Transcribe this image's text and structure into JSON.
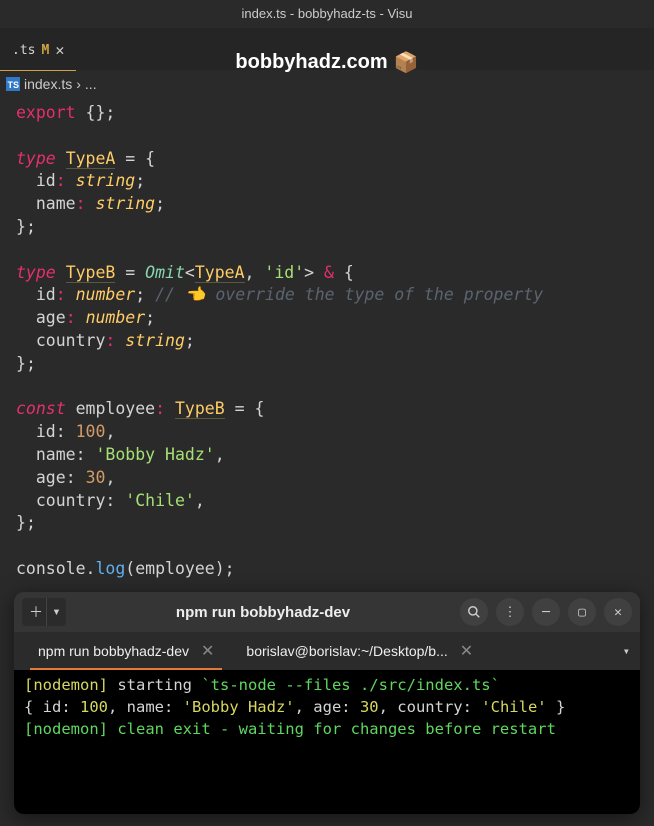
{
  "window": {
    "title": "index.ts - bobbyhadz-ts - Visu"
  },
  "header": {
    "site_name": "bobbyhadz.com",
    "icon": "📦"
  },
  "tabs": [
    {
      "filename": ".ts",
      "modified": "M",
      "close": "✕"
    }
  ],
  "breadcrumb": {
    "icon": "TS",
    "file": "index.ts",
    "sep": "›",
    "symbol": "..."
  },
  "code": {
    "l1": {
      "export": "export",
      "braces": "{}",
      "semi": ";"
    },
    "l2": {
      "type": "type",
      "name": "TypeA",
      "eq": " = ",
      "brace": "{"
    },
    "l3": {
      "prop": "id",
      "colon": ":",
      "ptype": "string",
      "semi": ";"
    },
    "l4": {
      "prop": "name",
      "colon": ":",
      "ptype": "string",
      "semi": ";"
    },
    "l5": {
      "brace": "}",
      "semi": ";"
    },
    "l6": {
      "type": "type",
      "name": "TypeB",
      "eq": " = ",
      "omit": "Omit",
      "lt": "<",
      "ref": "TypeA",
      "comma": ", ",
      "str": "'id'",
      "gt": ">",
      "amp": " & ",
      "brace": "{"
    },
    "l7": {
      "prop": "id",
      "colon": ":",
      "ptype": "number",
      "semi": ";",
      "comment": "// 👈️ override the type of the property"
    },
    "l8": {
      "prop": "age",
      "colon": ":",
      "ptype": "number",
      "semi": ";"
    },
    "l9": {
      "prop": "country",
      "colon": ":",
      "ptype": "string",
      "semi": ";"
    },
    "l10": {
      "brace": "}",
      "semi": ";"
    },
    "l11": {
      "const": "const",
      "name": "employee",
      "colon": ":",
      "tref": "TypeB",
      "eq": " = ",
      "brace": "{"
    },
    "l12": {
      "prop": "id",
      "val": "100"
    },
    "l13": {
      "prop": "name",
      "val": "'Bobby Hadz'"
    },
    "l14": {
      "prop": "age",
      "val": "30"
    },
    "l15": {
      "prop": "country",
      "val": "'Chile'"
    },
    "l16": {
      "brace": "}",
      "semi": ";"
    },
    "l17": {
      "obj": "console",
      "dot": ".",
      "method": "log",
      "paren": "(",
      "arg": "employee",
      "paren2": ")",
      "semi": ";"
    }
  },
  "terminal": {
    "title": "npm run bobbyhadz-dev",
    "tabs": [
      {
        "label": "npm run bobbyhadz-dev",
        "active": true
      },
      {
        "label": "borislav@borislav:~/Desktop/b...",
        "active": false
      }
    ],
    "output": {
      "l1a": "[nodemon]",
      "l1b": " starting ",
      "l1c": "`ts-node --files ./src/index.ts`",
      "l2a": "{ id: ",
      "l2b": "100",
      "l2c": ", name: ",
      "l2d": "'Bobby Hadz'",
      "l2e": ", age: ",
      "l2f": "30",
      "l2g": ", country: ",
      "l2h": "'Chile'",
      "l2i": " }",
      "l3a": "[nodemon]",
      "l3b": " clean exit - waiting for changes before restart"
    }
  }
}
